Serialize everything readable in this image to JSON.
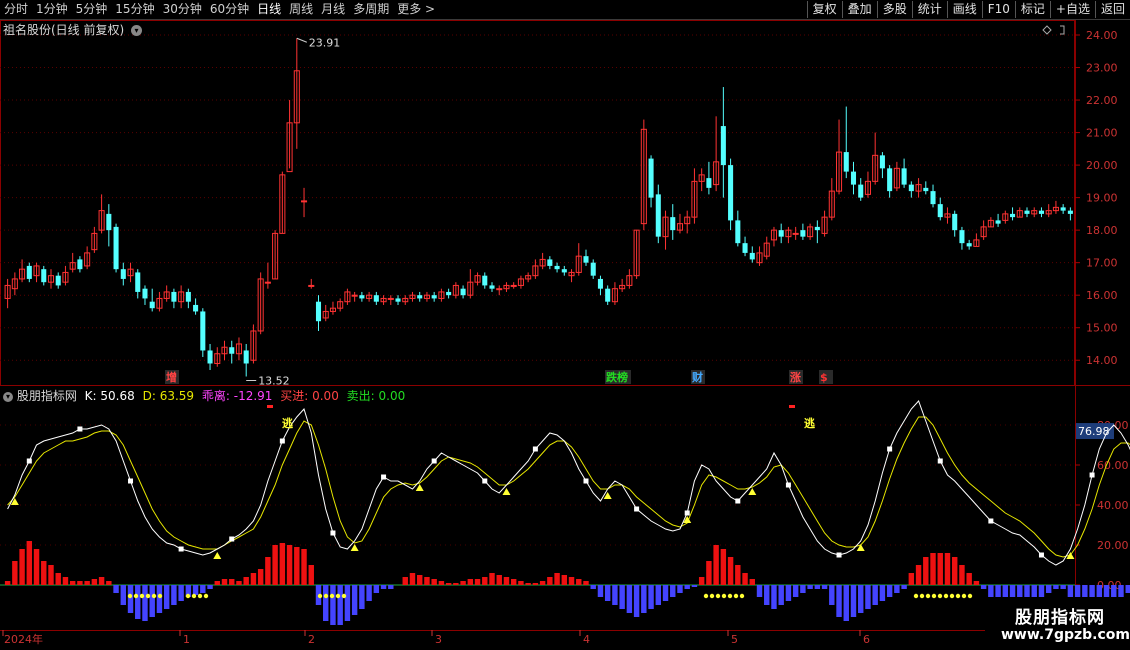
{
  "toolbar": {
    "period_tabs": [
      "分时",
      "1分钟",
      "5分钟",
      "15分钟",
      "30分钟",
      "60分钟",
      "日线",
      "周线",
      "月线",
      "多周期",
      "更多 >"
    ],
    "active_index": 6,
    "right_buttons": [
      "复权",
      "叠加",
      "多股",
      "统计",
      "画线",
      "F10",
      "标记",
      "+自选",
      "返回"
    ]
  },
  "main_panel": {
    "title": "祖名股份(日线 前复权)",
    "price_axis": [
      "24.00",
      "23.00",
      "22.00",
      "21.00",
      "20.00",
      "19.00",
      "18.00",
      "17.00",
      "16.00",
      "15.00",
      "14.00"
    ],
    "high_label": "23.91",
    "low_label": "13.52",
    "event_labels": [
      {
        "text": "增",
        "color": "#ff4444"
      },
      {
        "text": "跌榜",
        "color": "#22dd22"
      },
      {
        "text": "财",
        "color": "#44aaff"
      },
      {
        "text": "涨",
        "color": "#ff4444"
      },
      {
        "text": "$",
        "color": "#ff3333"
      }
    ]
  },
  "indicator_panel": {
    "name": "股朋指标网",
    "k_label": "K: 50.68",
    "d_label": "D: 63.59",
    "deviation_label": "乖离: -12.91",
    "buy_label": "买进: 0.00",
    "sell_label": "卖出: 0.00",
    "axis": [
      "80.00",
      "60.00",
      "40.00",
      "20.00",
      "0.00"
    ],
    "current_value": "76.98",
    "escape_label": "逃"
  },
  "time_axis": {
    "year_label": "2024年",
    "months": [
      "1",
      "2",
      "3",
      "4",
      "5",
      "6"
    ]
  },
  "watermark": {
    "line1": "股朋指标网",
    "line2": "www.7gpzb.com"
  },
  "colors": {
    "up": "#ff3333",
    "down": "#54ffff",
    "k_line": "#ffffff",
    "d_line": "#e6e600",
    "positive_bar": "#ee1111",
    "negative_bar": "#4444ff",
    "buy_marker": "#ffff33"
  },
  "chart_data": {
    "type": "candlestick",
    "price_range": [
      13.3,
      24.4
    ],
    "candles": [
      [
        15.9,
        16.3,
        16.5,
        15.6
      ],
      [
        16.2,
        16.5,
        16.7,
        16.0
      ],
      [
        16.5,
        16.8,
        17.1,
        16.4
      ],
      [
        16.9,
        16.5,
        17.0,
        16.4
      ],
      [
        16.6,
        16.9,
        17.0,
        16.4
      ],
      [
        16.8,
        16.4,
        16.9,
        16.3
      ],
      [
        16.4,
        16.6,
        16.8,
        16.2
      ],
      [
        16.6,
        16.3,
        16.7,
        16.2
      ],
      [
        16.4,
        16.7,
        16.9,
        16.3
      ],
      [
        16.8,
        17.0,
        17.3,
        16.7
      ],
      [
        17.1,
        16.8,
        17.2,
        16.7
      ],
      [
        16.9,
        17.3,
        17.5,
        16.8
      ],
      [
        17.4,
        17.9,
        18.1,
        17.3
      ],
      [
        18.0,
        18.6,
        19.1,
        17.9
      ],
      [
        18.5,
        18.0,
        18.8,
        17.5
      ],
      [
        18.1,
        16.8,
        18.2,
        16.7
      ],
      [
        16.8,
        16.5,
        17.0,
        16.3
      ],
      [
        16.6,
        16.8,
        17.0,
        16.4
      ],
      [
        16.7,
        16.1,
        16.8,
        15.9
      ],
      [
        16.2,
        15.9,
        16.3,
        15.7
      ],
      [
        15.8,
        15.6,
        16.2,
        15.5
      ],
      [
        15.6,
        15.9,
        16.1,
        15.5
      ],
      [
        15.9,
        16.1,
        16.3,
        15.8
      ],
      [
        16.1,
        15.8,
        16.2,
        15.6
      ],
      [
        15.8,
        16.1,
        16.3,
        15.6
      ],
      [
        16.1,
        15.8,
        16.2,
        15.6
      ],
      [
        15.7,
        15.5,
        15.9,
        15.4
      ],
      [
        15.5,
        14.3,
        15.6,
        14.1
      ],
      [
        14.3,
        13.9,
        14.5,
        13.7
      ],
      [
        13.9,
        14.2,
        14.4,
        13.8
      ],
      [
        14.2,
        14.4,
        14.6,
        14.0
      ],
      [
        14.4,
        14.2,
        14.6,
        13.9
      ],
      [
        14.2,
        14.5,
        14.7,
        14.0
      ],
      [
        14.3,
        13.9,
        14.5,
        13.5
      ],
      [
        14.0,
        14.9,
        15.1,
        13.9
      ],
      [
        14.9,
        16.5,
        16.7,
        14.8
      ],
      [
        16.4,
        16.4,
        17.0,
        16.2
      ],
      [
        16.5,
        17.9,
        18.0,
        16.5
      ],
      [
        17.9,
        19.7,
        19.8,
        17.9
      ],
      [
        19.8,
        21.3,
        22.0,
        19.9
      ],
      [
        21.3,
        22.9,
        23.9,
        20.5
      ],
      [
        18.9,
        18.9,
        19.3,
        18.4
      ],
      [
        16.3,
        16.3,
        16.5,
        16.2
      ],
      [
        15.8,
        15.2,
        16.0,
        14.9
      ],
      [
        15.3,
        15.5,
        15.7,
        15.2
      ],
      [
        15.5,
        15.6,
        15.8,
        15.4
      ],
      [
        15.6,
        15.8,
        15.9,
        15.5
      ],
      [
        15.8,
        16.1,
        16.2,
        15.7
      ],
      [
        16.0,
        16.0,
        16.1,
        15.8
      ],
      [
        16.0,
        15.9,
        16.1,
        15.8
      ],
      [
        15.9,
        16.0,
        16.1,
        15.8
      ],
      [
        16.0,
        15.8,
        16.1,
        15.7
      ],
      [
        15.8,
        15.9,
        16.0,
        15.7
      ],
      [
        15.9,
        15.9,
        16.0,
        15.7
      ],
      [
        15.9,
        15.8,
        16.0,
        15.7
      ],
      [
        15.8,
        15.9,
        16.0,
        15.7
      ],
      [
        15.9,
        16.0,
        16.1,
        15.8
      ],
      [
        16.0,
        15.9,
        16.1,
        15.8
      ],
      [
        15.9,
        16.0,
        16.1,
        15.8
      ],
      [
        16.0,
        15.9,
        16.1,
        15.8
      ],
      [
        15.9,
        16.1,
        16.2,
        15.8
      ],
      [
        16.1,
        16.0,
        16.2,
        15.9
      ],
      [
        16.0,
        16.3,
        16.4,
        15.9
      ],
      [
        16.2,
        16.0,
        16.3,
        15.9
      ],
      [
        16.0,
        16.4,
        16.8,
        15.9
      ],
      [
        16.4,
        16.6,
        16.7,
        16.3
      ],
      [
        16.6,
        16.3,
        16.7,
        16.2
      ],
      [
        16.3,
        16.2,
        16.4,
        16.1
      ],
      [
        16.2,
        16.2,
        16.3,
        16.0
      ],
      [
        16.2,
        16.3,
        16.4,
        16.1
      ],
      [
        16.3,
        16.3,
        16.4,
        16.2
      ],
      [
        16.3,
        16.5,
        16.6,
        16.2
      ],
      [
        16.5,
        16.6,
        16.7,
        16.4
      ],
      [
        16.6,
        16.9,
        17.1,
        16.5
      ],
      [
        16.9,
        17.1,
        17.3,
        16.8
      ],
      [
        17.1,
        16.9,
        17.2,
        16.8
      ],
      [
        16.9,
        16.8,
        17.0,
        16.7
      ],
      [
        16.8,
        16.7,
        16.9,
        16.6
      ],
      [
        16.6,
        16.7,
        16.8,
        16.4
      ],
      [
        16.7,
        17.2,
        17.6,
        16.6
      ],
      [
        17.2,
        17.0,
        17.4,
        16.9
      ],
      [
        17.0,
        16.6,
        17.1,
        16.5
      ],
      [
        16.5,
        16.2,
        16.6,
        16.0
      ],
      [
        16.2,
        15.8,
        16.3,
        15.7
      ],
      [
        15.8,
        16.2,
        16.4,
        15.7
      ],
      [
        16.2,
        16.3,
        16.5,
        16.1
      ],
      [
        16.3,
        16.6,
        16.8,
        16.2
      ],
      [
        16.6,
        18.0,
        18.0,
        16.5
      ],
      [
        18.2,
        21.1,
        21.4,
        18.0
      ],
      [
        20.2,
        19.0,
        20.3,
        18.7
      ],
      [
        19.1,
        17.8,
        19.4,
        17.6
      ],
      [
        17.8,
        18.4,
        18.6,
        17.4
      ],
      [
        18.4,
        18.0,
        18.8,
        17.7
      ],
      [
        18.0,
        18.2,
        18.5,
        17.9
      ],
      [
        18.2,
        18.4,
        18.6,
        17.9
      ],
      [
        18.4,
        19.5,
        19.9,
        18.2
      ],
      [
        19.5,
        19.7,
        19.9,
        19.2
      ],
      [
        19.6,
        19.3,
        20.1,
        19.1
      ],
      [
        19.4,
        20.1,
        21.5,
        19.2
      ],
      [
        21.2,
        20.0,
        22.4,
        19.0
      ],
      [
        20.0,
        18.3,
        20.2,
        18.0
      ],
      [
        18.3,
        17.6,
        18.6,
        17.5
      ],
      [
        17.6,
        17.3,
        17.8,
        17.2
      ],
      [
        17.3,
        17.1,
        17.5,
        17.0
      ],
      [
        17.0,
        17.3,
        17.5,
        16.9
      ],
      [
        17.2,
        17.6,
        17.8,
        17.1
      ],
      [
        17.7,
        18.0,
        18.1,
        17.5
      ],
      [
        18.0,
        17.8,
        18.2,
        17.6
      ],
      [
        17.8,
        18.0,
        18.1,
        17.6
      ],
      [
        17.9,
        17.9,
        18.1,
        17.7
      ],
      [
        18.0,
        17.8,
        18.2,
        17.7
      ],
      [
        17.8,
        18.1,
        18.2,
        17.7
      ],
      [
        18.1,
        18.0,
        18.3,
        17.6
      ],
      [
        17.9,
        18.4,
        18.6,
        17.8
      ],
      [
        18.4,
        19.2,
        19.6,
        18.3
      ],
      [
        19.2,
        20.4,
        21.4,
        19.1
      ],
      [
        20.4,
        19.8,
        21.8,
        19.6
      ],
      [
        19.8,
        19.4,
        20.1,
        19.1
      ],
      [
        19.4,
        19.0,
        19.6,
        18.9
      ],
      [
        19.1,
        19.5,
        19.8,
        19.0
      ],
      [
        19.5,
        20.3,
        21.0,
        19.4
      ],
      [
        20.3,
        19.9,
        20.4,
        19.6
      ],
      [
        19.9,
        19.2,
        20.0,
        19.0
      ],
      [
        19.3,
        19.9,
        20.1,
        19.2
      ],
      [
        19.9,
        19.4,
        20.2,
        19.3
      ],
      [
        19.4,
        19.2,
        19.5,
        19.0
      ],
      [
        19.2,
        19.4,
        19.6,
        19.0
      ],
      [
        19.3,
        19.2,
        19.5,
        19.1
      ],
      [
        19.2,
        18.8,
        19.4,
        18.7
      ],
      [
        18.8,
        18.4,
        19.0,
        18.3
      ],
      [
        18.4,
        18.5,
        18.7,
        18.2
      ],
      [
        18.5,
        18.0,
        18.6,
        17.8
      ],
      [
        18.0,
        17.6,
        18.1,
        17.4
      ],
      [
        17.6,
        17.5,
        17.7,
        17.4
      ],
      [
        17.5,
        17.7,
        17.9,
        17.5
      ],
      [
        17.8,
        18.1,
        18.3,
        17.7
      ],
      [
        18.1,
        18.3,
        18.4,
        18.1
      ],
      [
        18.3,
        18.2,
        18.5,
        18.1
      ],
      [
        18.3,
        18.5,
        18.6,
        18.2
      ],
      [
        18.5,
        18.4,
        18.7,
        18.3
      ],
      [
        18.4,
        18.6,
        18.7,
        18.4
      ],
      [
        18.6,
        18.5,
        18.7,
        18.4
      ],
      [
        18.5,
        18.6,
        18.7,
        18.4
      ],
      [
        18.6,
        18.5,
        18.7,
        18.4
      ],
      [
        18.5,
        18.6,
        18.8,
        18.4
      ],
      [
        18.6,
        18.7,
        18.9,
        18.5
      ],
      [
        18.7,
        18.6,
        18.8,
        18.5
      ],
      [
        18.6,
        18.5,
        18.7,
        18.3
      ]
    ],
    "k_values": [
      38,
      45,
      55,
      62,
      70,
      72,
      73,
      74,
      75,
      76,
      78,
      78,
      79,
      80,
      78,
      72,
      62,
      52,
      42,
      34,
      28,
      24,
      21,
      20,
      18,
      17,
      16,
      15,
      16,
      18,
      20,
      23,
      25,
      28,
      32,
      40,
      52,
      62,
      72,
      79,
      84,
      88,
      76,
      55,
      38,
      26,
      19,
      18,
      22,
      28,
      38,
      48,
      54,
      52,
      52,
      50,
      48,
      52,
      58,
      62,
      66,
      64,
      62,
      60,
      58,
      56,
      52,
      48,
      46,
      50,
      54,
      58,
      62,
      68,
      72,
      76,
      75,
      72,
      66,
      58,
      52,
      46,
      42,
      48,
      52,
      50,
      44,
      38,
      35,
      32,
      30,
      28,
      27,
      28,
      36,
      52,
      60,
      58,
      52,
      48,
      44,
      42,
      46,
      50,
      54,
      58,
      66,
      60,
      50,
      42,
      34,
      28,
      22,
      18,
      16,
      15,
      16,
      18,
      22,
      30,
      42,
      56,
      68,
      76,
      82,
      88,
      92,
      82,
      72,
      62,
      55,
      52,
      48,
      44,
      40,
      36,
      32,
      30,
      28,
      26,
      25,
      22,
      19,
      15,
      12,
      10,
      12,
      18,
      28,
      40,
      55,
      68,
      76,
      80,
      76,
      70,
      62,
      50
    ],
    "d_values": [
      40,
      44,
      50,
      56,
      62,
      66,
      68,
      70,
      72,
      72,
      73,
      74,
      76,
      77,
      77,
      75,
      70,
      62,
      54,
      46,
      38,
      32,
      27,
      24,
      22,
      20,
      19,
      18,
      18,
      18,
      20,
      22,
      24,
      26,
      28,
      34,
      42,
      50,
      60,
      68,
      76,
      82,
      80,
      70,
      58,
      44,
      32,
      24,
      21,
      22,
      28,
      36,
      44,
      48,
      50,
      51,
      50,
      51,
      54,
      58,
      62,
      64,
      63,
      62,
      61,
      59,
      56,
      53,
      50,
      50,
      52,
      55,
      58,
      62,
      66,
      70,
      72,
      72,
      69,
      64,
      58,
      52,
      48,
      48,
      50,
      50,
      48,
      44,
      41,
      38,
      35,
      32,
      30,
      29,
      31,
      40,
      50,
      55,
      54,
      52,
      50,
      48,
      48,
      49,
      51,
      54,
      59,
      60,
      56,
      50,
      44,
      38,
      32,
      26,
      22,
      20,
      19,
      19,
      20,
      24,
      32,
      42,
      53,
      63,
      71,
      78,
      84,
      84,
      80,
      73,
      66,
      60,
      55,
      51,
      48,
      45,
      42,
      39,
      36,
      34,
      32,
      29,
      26,
      22,
      18,
      15,
      14,
      15,
      20,
      28,
      38,
      50,
      60,
      68,
      71,
      71,
      68,
      64
    ],
    "bar_values": [
      2,
      12,
      18,
      22,
      18,
      12,
      10,
      6,
      4,
      2,
      2,
      2,
      3,
      4,
      2,
      -4,
      -10,
      -14,
      -17,
      -18,
      -16,
      -14,
      -12,
      -10,
      -8,
      -6,
      -5,
      -4,
      -2,
      2,
      3,
      3,
      2,
      4,
      6,
      8,
      14,
      20,
      21,
      20,
      19,
      18,
      10,
      -10,
      -18,
      -20,
      -20,
      -18,
      -15,
      -12,
      -8,
      -4,
      -2,
      -2,
      0,
      4,
      6,
      5,
      4,
      3,
      2,
      1,
      1,
      2,
      3,
      3,
      4,
      6,
      5,
      4,
      3,
      2,
      1,
      1,
      2,
      4,
      6,
      5,
      4,
      3,
      2,
      -2,
      -6,
      -8,
      -10,
      -12,
      -14,
      -16,
      -14,
      -12,
      -10,
      -8,
      -6,
      -4,
      -2,
      -1,
      4,
      12,
      20,
      18,
      14,
      10,
      6,
      3,
      -6,
      -10,
      -12,
      -10,
      -8,
      -6,
      -4,
      -2,
      -2,
      -2,
      -10,
      -16,
      -18,
      -16,
      -14,
      -12,
      -10,
      -8,
      -6,
      -4,
      -2,
      6,
      10,
      14,
      16,
      16,
      16,
      14,
      10,
      6,
      2,
      -2,
      -6,
      -10,
      -8,
      -6,
      -10,
      -12,
      -8,
      -6,
      -4,
      -2,
      -2,
      -6,
      -8,
      -8,
      -8,
      -8,
      -6,
      -8,
      -6,
      -4,
      -2,
      -2,
      2,
      6,
      8,
      10,
      14,
      16,
      18,
      20,
      21,
      20,
      18,
      14,
      10,
      6,
      2,
      -2,
      -6,
      -8
    ]
  }
}
